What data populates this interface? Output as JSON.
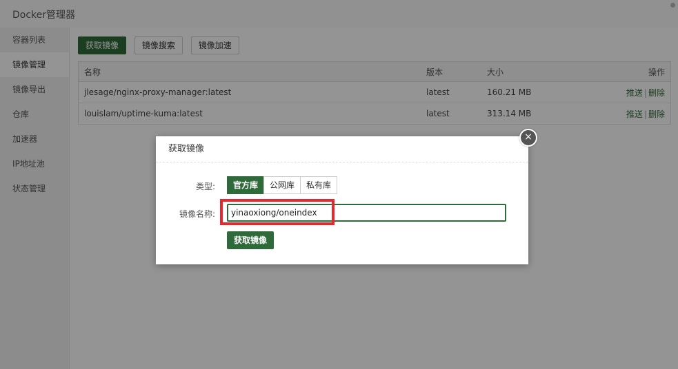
{
  "window": {
    "title": "Docker管理器"
  },
  "sidebar": {
    "items": [
      {
        "label": "容器列表"
      },
      {
        "label": "镜像管理"
      },
      {
        "label": "镜像导出"
      },
      {
        "label": "仓库"
      },
      {
        "label": "加速器"
      },
      {
        "label": "IP地址池"
      },
      {
        "label": "状态管理"
      }
    ]
  },
  "toolbar": {
    "pull_label": "获取镜像",
    "search_label": "镜像搜索",
    "accelerate_label": "镜像加速"
  },
  "table": {
    "headers": {
      "name": "名称",
      "version": "版本",
      "size": "大小",
      "ops": "操作"
    },
    "rows": [
      {
        "name": "jlesage/nginx-proxy-manager:latest",
        "version": "latest",
        "size": "160.21 MB",
        "op_push": "推送",
        "op_sep": "|",
        "op_delete": "删除"
      },
      {
        "name": "louislam/uptime-kuma:latest",
        "version": "latest",
        "size": "313.14 MB",
        "op_push": "推送",
        "op_sep": "|",
        "op_delete": "删除"
      }
    ]
  },
  "modal": {
    "title": "获取镜像",
    "close_icon": "×",
    "type_label": "类型:",
    "type_options": [
      "官方库",
      "公网库",
      "私有库"
    ],
    "name_label": "镜像名称:",
    "name_value": "yinaoxiong/oneindex",
    "submit_label": "获取镜像"
  },
  "colors": {
    "accent": "#2f6b3a",
    "highlight": "#e8282e"
  }
}
